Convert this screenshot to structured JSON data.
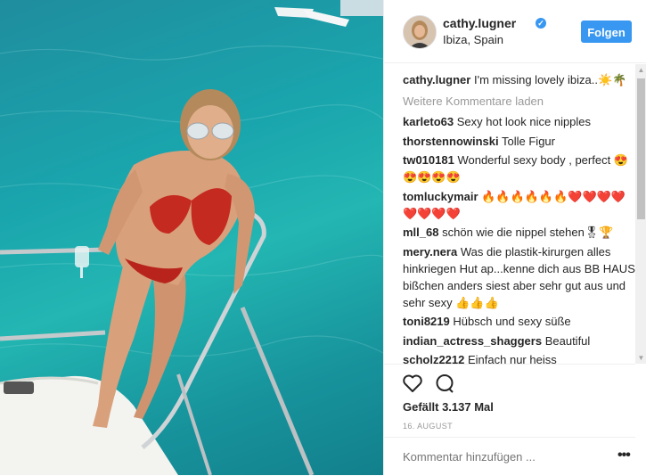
{
  "post": {
    "username": "cathy.lugner",
    "verified_badge": "verified-icon",
    "location": "Ibiza, Spain",
    "follow_label": "Folgen"
  },
  "caption": {
    "user": "cathy.lugner",
    "text": "I'm missing lovely ibiza..☀️🌴"
  },
  "load_more": "Weitere Kommentare laden",
  "comments": [
    {
      "user": "karleto63",
      "text": "Sexy hot look nice nipples"
    },
    {
      "user": "thorstennowinski",
      "text": "Tolle Figur"
    },
    {
      "user": "tw010181",
      "text": "Wonderful sexy body , perfect 😍😍😍😍😍"
    },
    {
      "user": "tomluckymair",
      "text": "🔥🔥🔥🔥🔥🔥❤️❤️❤️❤️❤️❤️❤️❤️"
    },
    {
      "user": "mll_68",
      "text": "schön wie die nippel stehen🎖🏆"
    },
    {
      "user": "mery.nera",
      "text": "Was die plastik-kirurgen alles hinkriegen Hut ap...kenne dich aus BB HAUS bißchen anders siest aber sehr gut aus und sehr sexy 👍👍👍"
    },
    {
      "user": "toni8219",
      "text": "Hübsch und sexy süße"
    },
    {
      "user": "indian_actress_shaggers",
      "text": "Beautiful"
    },
    {
      "user": "scholz2212",
      "text": "Einfach nur heiss"
    }
  ],
  "likes": "Gefällt 3.137 Mal",
  "date": "16. AUGUST",
  "add_comment_placeholder": "Kommentar hinzufügen ...",
  "more_options": "•••",
  "colors": {
    "accent": "#3897f0",
    "text": "#262626",
    "muted": "#999999"
  }
}
